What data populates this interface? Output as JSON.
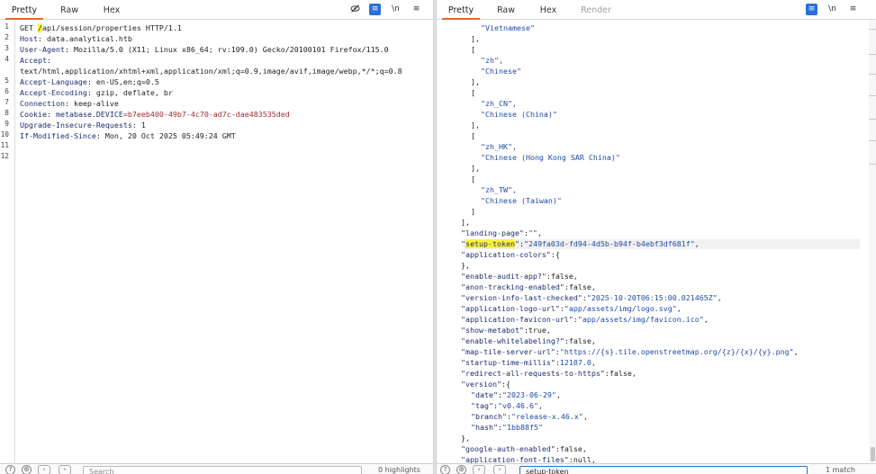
{
  "request": {
    "tabs": [
      "Pretty",
      "Raw",
      "Hex"
    ],
    "active_tab": "Pretty",
    "toolbar": {
      "hide_icon": "eye-slash-icon",
      "wrap_icon": "wrap-icon",
      "newline_label": "\\n",
      "menu_icon": "menu-icon"
    },
    "line_numbers": [
      "1",
      "2",
      "3",
      "4",
      "",
      "5",
      "6",
      "7",
      "8",
      "9",
      "10",
      "11",
      "12"
    ],
    "lines": [
      {
        "parts": [
          {
            "t": "GET ",
            "c": "p"
          },
          {
            "t": "/",
            "c": "hl"
          },
          {
            "t": "api/session/properties HTTP/1.1",
            "c": "p"
          }
        ]
      },
      {
        "parts": [
          {
            "t": "Host",
            "c": "k"
          },
          {
            "t": ": data.analytical.htb",
            "c": "p"
          }
        ]
      },
      {
        "parts": [
          {
            "t": "User-Agent",
            "c": "k"
          },
          {
            "t": ": Mozilla/5.0 (X11; Linux x86_64; rv:109.0) Gecko/20100101 Firefox/115.0",
            "c": "p"
          }
        ]
      },
      {
        "parts": [
          {
            "t": "Accept",
            "c": "k"
          },
          {
            "t": ":",
            "c": "p"
          }
        ]
      },
      {
        "parts": [
          {
            "t": "text/html,application/xhtml+xml,application/xml;q=0.9,image/avif,image/webp,*/*;q=0.8",
            "c": "p"
          }
        ]
      },
      {
        "parts": [
          {
            "t": "Accept-Language",
            "c": "k"
          },
          {
            "t": ": en-US,en;q=0.5",
            "c": "p"
          }
        ]
      },
      {
        "parts": [
          {
            "t": "Accept-Encoding",
            "c": "k"
          },
          {
            "t": ": gzip, deflate, br",
            "c": "p"
          }
        ]
      },
      {
        "parts": [
          {
            "t": "Connection",
            "c": "k"
          },
          {
            "t": ": keep-alive",
            "c": "p"
          }
        ]
      },
      {
        "parts": [
          {
            "t": "Cookie",
            "c": "k"
          },
          {
            "t": ": metabase.DEVICE",
            "c": "k"
          },
          {
            "t": "=b7eeb400-49b7-4c70-ad7c-dae483535ded",
            "c": "cv"
          }
        ]
      },
      {
        "parts": [
          {
            "t": "Upgrade-Insecure-Requests",
            "c": "k"
          },
          {
            "t": ": 1",
            "c": "p"
          }
        ]
      },
      {
        "parts": [
          {
            "t": "If-Modified-Since",
            "c": "k"
          },
          {
            "t": ": Mon, 20 Oct 2025 05:49:24 GMT",
            "c": "p"
          }
        ]
      },
      {
        "parts": []
      },
      {
        "parts": []
      }
    ],
    "bottom": {
      "search_placeholder": "Search",
      "match_count": "0 highlights"
    }
  },
  "response": {
    "tabs": [
      "Pretty",
      "Raw",
      "Hex",
      "Render"
    ],
    "active_tab": "Pretty",
    "toolbar": {
      "wrap_icon": "wrap-icon",
      "newline_label": "\\n",
      "menu_icon": "menu-icon"
    },
    "lines": [
      {
        "indent": 3,
        "parts": [
          {
            "t": "\"Vietnamese\"",
            "c": "s"
          }
        ]
      },
      {
        "indent": 2,
        "parts": [
          {
            "t": "],",
            "c": "p"
          }
        ]
      },
      {
        "indent": 2,
        "parts": [
          {
            "t": "[",
            "c": "p"
          }
        ]
      },
      {
        "indent": 3,
        "parts": [
          {
            "t": "\"zh\",",
            "c": "s"
          }
        ]
      },
      {
        "indent": 3,
        "parts": [
          {
            "t": "\"Chinese\"",
            "c": "s"
          }
        ]
      },
      {
        "indent": 2,
        "parts": [
          {
            "t": "],",
            "c": "p"
          }
        ]
      },
      {
        "indent": 2,
        "parts": [
          {
            "t": "[",
            "c": "p"
          }
        ]
      },
      {
        "indent": 3,
        "parts": [
          {
            "t": "\"zh_CN\",",
            "c": "s"
          }
        ]
      },
      {
        "indent": 3,
        "parts": [
          {
            "t": "\"Chinese (China)\"",
            "c": "s"
          }
        ]
      },
      {
        "indent": 2,
        "parts": [
          {
            "t": "],",
            "c": "p"
          }
        ]
      },
      {
        "indent": 2,
        "parts": [
          {
            "t": "[",
            "c": "p"
          }
        ]
      },
      {
        "indent": 3,
        "parts": [
          {
            "t": "\"zh_HK\",",
            "c": "s"
          }
        ]
      },
      {
        "indent": 3,
        "parts": [
          {
            "t": "\"Chinese (Hong Kong SAR China)\"",
            "c": "s"
          }
        ]
      },
      {
        "indent": 2,
        "parts": [
          {
            "t": "],",
            "c": "p"
          }
        ]
      },
      {
        "indent": 2,
        "parts": [
          {
            "t": "[",
            "c": "p"
          }
        ]
      },
      {
        "indent": 3,
        "parts": [
          {
            "t": "\"zh_TW\",",
            "c": "s"
          }
        ]
      },
      {
        "indent": 3,
        "parts": [
          {
            "t": "\"Chinese (Taiwan)\"",
            "c": "s"
          }
        ]
      },
      {
        "indent": 2,
        "parts": [
          {
            "t": "]",
            "c": "p"
          }
        ]
      },
      {
        "indent": 1,
        "parts": [
          {
            "t": "],",
            "c": "p"
          }
        ]
      },
      {
        "indent": 1,
        "parts": [
          {
            "t": "\"landing-page\"",
            "c": "k"
          },
          {
            "t": ":",
            "c": "p"
          },
          {
            "t": "\"\"",
            "c": "s"
          },
          {
            "t": ",",
            "c": "p"
          }
        ]
      },
      {
        "indent": 1,
        "highlight_row": true,
        "parts": [
          {
            "t": "\"",
            "c": "k"
          },
          {
            "t": "setup-token",
            "c": "hlk"
          },
          {
            "t": "\"",
            "c": "k"
          },
          {
            "t": ":",
            "c": "p"
          },
          {
            "t": "\"249fa03d-fd94-4d5b-b94f-b4ebf3df681f\"",
            "c": "s"
          },
          {
            "t": ",",
            "c": "p"
          }
        ]
      },
      {
        "indent": 1,
        "parts": [
          {
            "t": "\"application-colors\"",
            "c": "k"
          },
          {
            "t": ":{",
            "c": "p"
          }
        ]
      },
      {
        "indent": 1,
        "parts": [
          {
            "t": "},",
            "c": "p"
          }
        ]
      },
      {
        "indent": 1,
        "parts": [
          {
            "t": "\"enable-audit-app?\"",
            "c": "k"
          },
          {
            "t": ":false,",
            "c": "p"
          }
        ]
      },
      {
        "indent": 1,
        "parts": [
          {
            "t": "\"anon-tracking-enabled\"",
            "c": "k"
          },
          {
            "t": ":false,",
            "c": "p"
          }
        ]
      },
      {
        "indent": 1,
        "parts": [
          {
            "t": "\"version-info-last-checked\"",
            "c": "k"
          },
          {
            "t": ":",
            "c": "p"
          },
          {
            "t": "\"2025-10-20T06:15:00.021465Z\"",
            "c": "s"
          },
          {
            "t": ",",
            "c": "p"
          }
        ]
      },
      {
        "indent": 1,
        "parts": [
          {
            "t": "\"application-logo-url\"",
            "c": "k"
          },
          {
            "t": ":",
            "c": "p"
          },
          {
            "t": "\"app/assets/img/logo.svg\"",
            "c": "s"
          },
          {
            "t": ",",
            "c": "p"
          }
        ]
      },
      {
        "indent": 1,
        "parts": [
          {
            "t": "\"application-favicon-url\"",
            "c": "k"
          },
          {
            "t": ":",
            "c": "p"
          },
          {
            "t": "\"app/assets/img/favicon.ico\"",
            "c": "s"
          },
          {
            "t": ",",
            "c": "p"
          }
        ]
      },
      {
        "indent": 1,
        "parts": [
          {
            "t": "\"show-metabot\"",
            "c": "k"
          },
          {
            "t": ":true,",
            "c": "p"
          }
        ]
      },
      {
        "indent": 1,
        "parts": [
          {
            "t": "\"enable-whitelabeling?\"",
            "c": "k"
          },
          {
            "t": ":false,",
            "c": "p"
          }
        ]
      },
      {
        "indent": 1,
        "parts": [
          {
            "t": "\"map-tile-server-url\"",
            "c": "k"
          },
          {
            "t": ":",
            "c": "p"
          },
          {
            "t": "\"https://{s}.tile.openstreetmap.org/{z}/{x}/{y}.png\"",
            "c": "s"
          },
          {
            "t": ",",
            "c": "p"
          }
        ]
      },
      {
        "indent": 1,
        "parts": [
          {
            "t": "\"startup-time-millis\"",
            "c": "k"
          },
          {
            "t": ":",
            "c": "p"
          },
          {
            "t": "12187.0",
            "c": "s"
          },
          {
            "t": ",",
            "c": "p"
          }
        ]
      },
      {
        "indent": 1,
        "parts": [
          {
            "t": "\"redirect-all-requests-to-https\"",
            "c": "k"
          },
          {
            "t": ":false,",
            "c": "p"
          }
        ]
      },
      {
        "indent": 1,
        "parts": [
          {
            "t": "\"version\"",
            "c": "k"
          },
          {
            "t": ":{",
            "c": "p"
          }
        ]
      },
      {
        "indent": 2,
        "parts": [
          {
            "t": "\"date\"",
            "c": "k"
          },
          {
            "t": ":",
            "c": "p"
          },
          {
            "t": "\"2023-06-29\"",
            "c": "s"
          },
          {
            "t": ",",
            "c": "p"
          }
        ]
      },
      {
        "indent": 2,
        "parts": [
          {
            "t": "\"tag\"",
            "c": "k"
          },
          {
            "t": ":",
            "c": "p"
          },
          {
            "t": "\"v0.46.6\"",
            "c": "s"
          },
          {
            "t": ",",
            "c": "p"
          }
        ]
      },
      {
        "indent": 2,
        "parts": [
          {
            "t": "\"branch\"",
            "c": "k"
          },
          {
            "t": ":",
            "c": "p"
          },
          {
            "t": "\"release-x.46.x\"",
            "c": "s"
          },
          {
            "t": ",",
            "c": "p"
          }
        ]
      },
      {
        "indent": 2,
        "parts": [
          {
            "t": "\"hash\"",
            "c": "k"
          },
          {
            "t": ":",
            "c": "p"
          },
          {
            "t": "\"1bb88f5\"",
            "c": "s"
          }
        ]
      },
      {
        "indent": 1,
        "parts": [
          {
            "t": "},",
            "c": "p"
          }
        ]
      },
      {
        "indent": 1,
        "parts": [
          {
            "t": "\"google-auth-enabled\"",
            "c": "k"
          },
          {
            "t": ":false,",
            "c": "p"
          }
        ]
      },
      {
        "indent": 1,
        "parts": [
          {
            "t": "\"application-font-files\"",
            "c": "k"
          },
          {
            "t": ":null,",
            "c": "p"
          }
        ]
      }
    ],
    "bottom": {
      "search_value": "setup-token",
      "match_count": "1 match"
    }
  }
}
